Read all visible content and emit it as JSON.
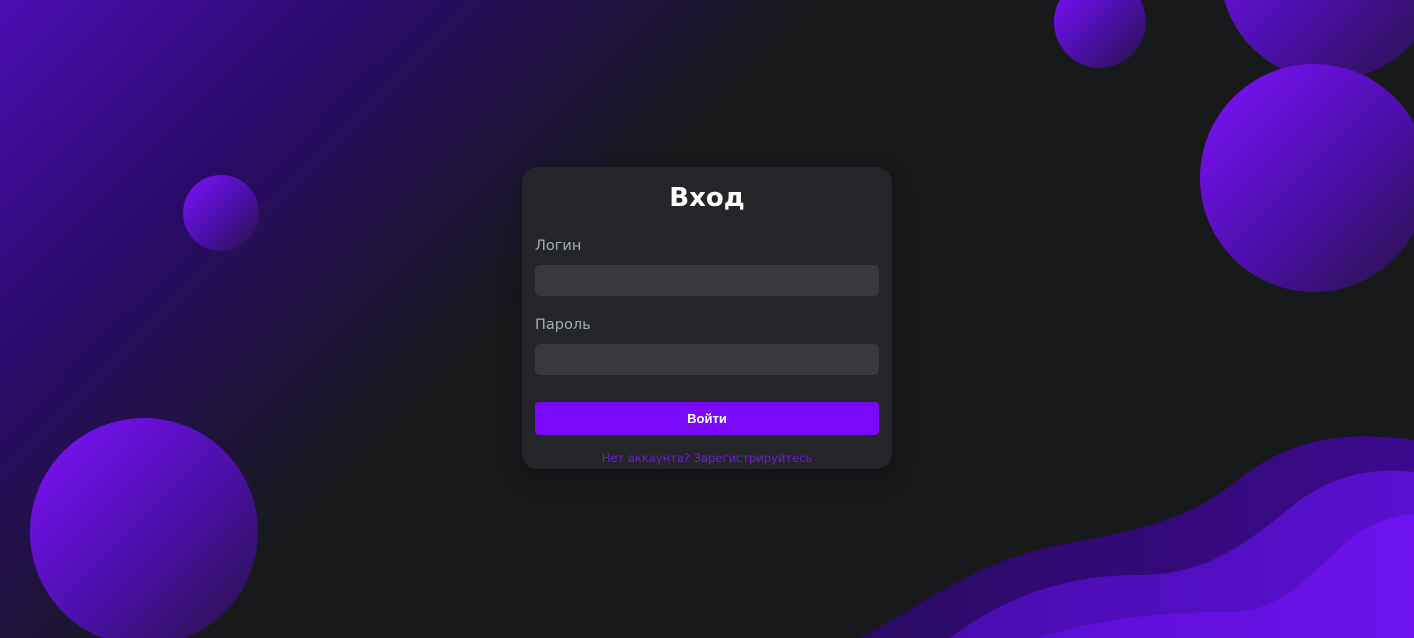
{
  "colors": {
    "background": "#17191b",
    "card": "#232528",
    "input": "#37393e",
    "accent": "#7a08f9",
    "link": "#6d1dd8",
    "label": "#a7adb4"
  },
  "login_form": {
    "title": "Вход",
    "login_label": "Логин",
    "login_value": "",
    "password_label": "Пароль",
    "password_value": "",
    "submit_label": "Войти",
    "register_link": "Нет аккаунта? Зарегистрируйтесь"
  }
}
